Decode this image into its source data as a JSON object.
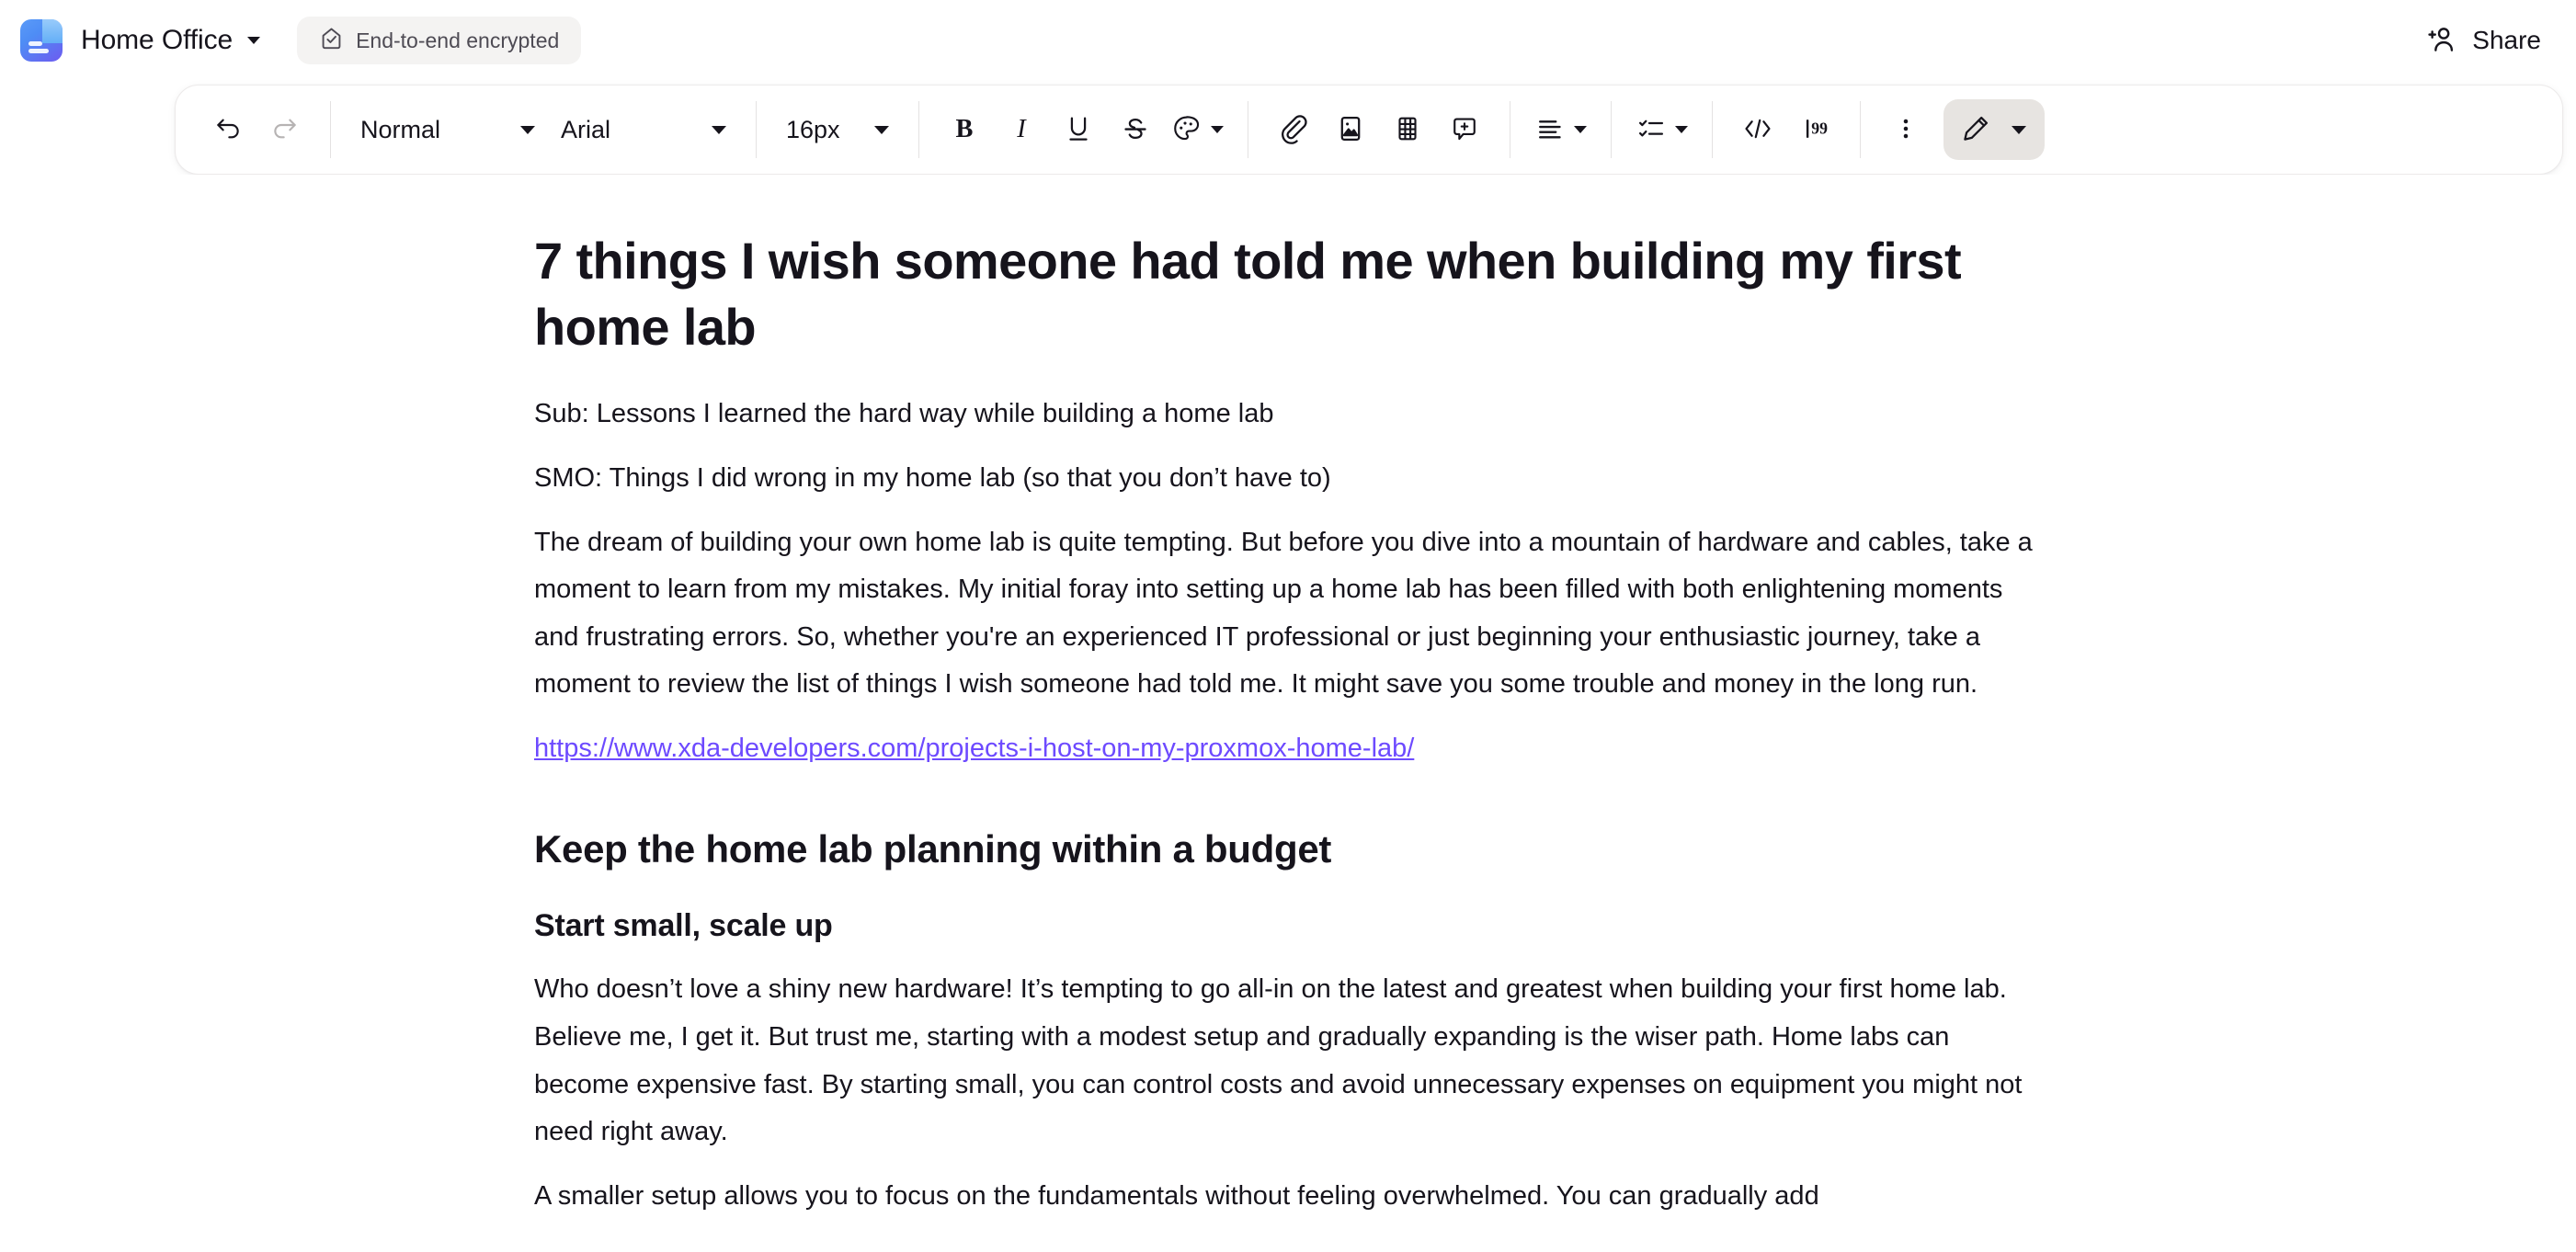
{
  "header": {
    "logo_icon": "proton-docs-logo-icon",
    "doc_title": "Home Office",
    "title_caret_icon": "chevron-down-icon",
    "encryption_badge": {
      "icon": "lock-check-icon",
      "label": "End-to-end encrypted"
    },
    "share": {
      "icon": "person-add-icon",
      "label": "Share"
    }
  },
  "toolbar": {
    "undo": {
      "icon": "undo-arrow-icon",
      "label": "Undo"
    },
    "redo": {
      "icon": "redo-arrow-icon",
      "label": "Redo"
    },
    "paragraph_style": {
      "value": "Normal",
      "caret_icon": "chevron-down-icon"
    },
    "font_family": {
      "value": "Arial",
      "caret_icon": "chevron-down-icon"
    },
    "font_size": {
      "value": "16px",
      "caret_icon": "chevron-down-icon"
    },
    "bold": {
      "icon": "bold-icon",
      "label": "B"
    },
    "italic": {
      "icon": "italic-icon",
      "label": "I"
    },
    "underline": {
      "icon": "underline-icon",
      "label": "U"
    },
    "strikethrough": {
      "icon": "strikethrough-icon",
      "label": "S"
    },
    "text_color": {
      "icon": "color-palette-icon",
      "caret_icon": "chevron-down-icon"
    },
    "link": {
      "icon": "link-paperclip-icon"
    },
    "image": {
      "icon": "image-icon"
    },
    "table": {
      "icon": "table-icon"
    },
    "comment": {
      "icon": "comment-add-icon"
    },
    "align": {
      "icon": "align-left-icon",
      "caret_icon": "chevron-down-icon"
    },
    "lists": {
      "icon": "checklist-icon",
      "caret_icon": "chevron-down-icon"
    },
    "code": {
      "icon": "code-brackets-icon"
    },
    "quote": {
      "icon": "block-quote-icon"
    },
    "more": {
      "icon": "more-vertical-icon"
    },
    "edit_mode": {
      "icon": "pencil-icon",
      "caret_icon": "chevron-down-icon",
      "active": true
    }
  },
  "document": {
    "title": "7 things I wish someone had told me when building my first home lab",
    "subtitle_line": "Sub: Lessons I learned the hard way while building a home lab",
    "smo_line": "SMO: Things I did wrong in my home lab (so that you don’t have to)",
    "intro_paragraph": "The dream of building your own home lab is quite tempting. But before you dive into a mountain of hardware and cables, take a moment to learn from my mistakes. My initial foray into setting up a home lab has been filled with both enlightening moments and frustrating errors. So, whether you're an experienced IT professional or just beginning your enthusiastic journey, take a moment to review the list of things I wish someone had told me. It might save you some trouble and money in the long run.",
    "link_text": "https://www.xda-developers.com/projects-i-host-on-my-proxmox-home-lab/",
    "heading_budget": "Keep the home lab planning within a budget",
    "heading_start_small": "Start small, scale up",
    "paragraph_start_small": "Who doesn’t love a shiny new hardware! It’s tempting to go all-in on the latest and greatest when building your first home lab. Believe me, I get it. But trust me, starting with a modest setup and gradually expanding is the wiser path. Home labs can become expensive fast. By starting small, you can control costs and avoid unnecessary expenses on equipment you might not need right away.",
    "paragraph_clipped": "A smaller setup allows you to focus on the fundamentals without feeling overwhelmed. You can gradually add"
  },
  "colors": {
    "link_purple": "#6d4aff",
    "text": "#16141c",
    "toolbar_border": "#eceaea",
    "active_pill": "#e7e4e1",
    "badge_bg": "#f4f3f2"
  }
}
